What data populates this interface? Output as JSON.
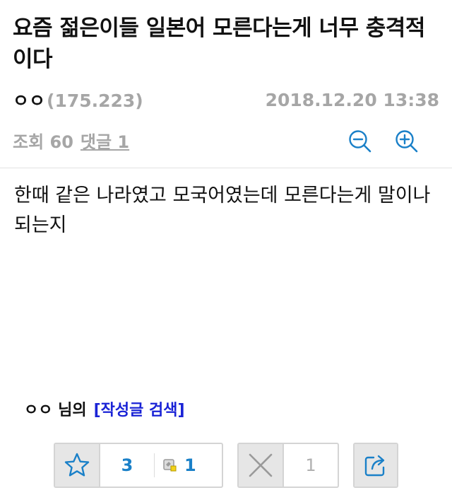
{
  "post": {
    "title": "요즘 젊은이들 일본어 모른다는게 너무 충격적이다",
    "author": "ㅇㅇ",
    "ip": "(175.223)",
    "date": "2018.12.20 13:38",
    "views_label": "조회 60",
    "comments_label": "댓글 1",
    "body": "한때 같은 나라였고 모국어였는데 모른다는게 말이나 되는지"
  },
  "author_search": {
    "name_label": "ㅇㅇ 님의",
    "link_label": "[작성글 검색]"
  },
  "actions": {
    "recommend_count": "3",
    "fixed_recommend_count": "1",
    "dislike_count": "1"
  },
  "colors": {
    "accent_blue": "#1a80c8",
    "link_blue": "#1a23d6",
    "muted_grey": "#a6a6a6"
  },
  "icons": [
    "zoom-out-icon",
    "zoom-in-icon",
    "star-icon",
    "badge-icon",
    "x-icon",
    "share-icon"
  ]
}
